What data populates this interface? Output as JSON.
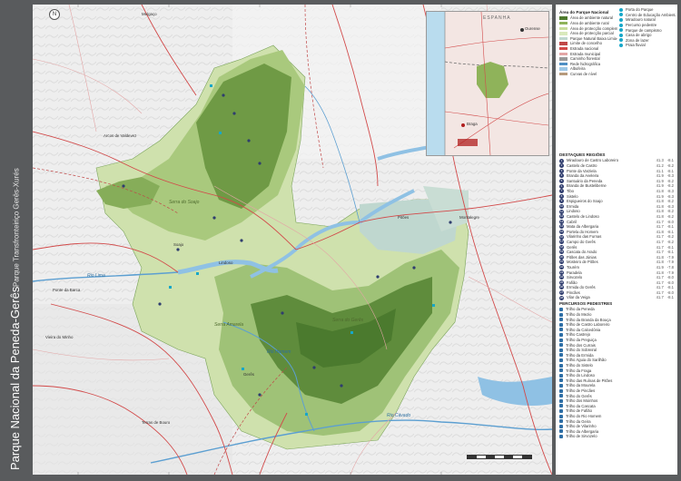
{
  "side_title": {
    "main": "Parque Nacional da Peneda-Gerês",
    "sub": "Parque Transfronteiriço Gerês-Xurés"
  },
  "compass": "N",
  "inset": {
    "country": "ESPANHA",
    "city1": "Ourense",
    "city2": "Braga"
  },
  "places": [
    {
      "id": "arcos",
      "label": "Arcos de Valdevez"
    },
    {
      "id": "ponte",
      "label": "Ponte da Barca"
    },
    {
      "id": "vieira",
      "label": "Vieira do Minho"
    },
    {
      "id": "terras",
      "label": "Terras de Bouro"
    },
    {
      "id": "montalegre",
      "label": "Montalegre"
    },
    {
      "id": "melgaco",
      "label": "Melgaço"
    },
    {
      "id": "soajo",
      "label": "Soajo"
    },
    {
      "id": "geres",
      "label": "Gerês"
    },
    {
      "id": "lindoso",
      "label": "Lindoso"
    },
    {
      "id": "pitoes",
      "label": "Pitões"
    }
  ],
  "rivers": [
    {
      "label": "Rio Lima"
    },
    {
      "label": "Rio Cávado"
    },
    {
      "label": "Rio Homem"
    }
  ],
  "serras": [
    {
      "label": "Serra do Soajo"
    },
    {
      "label": "Serra do Gerês"
    },
    {
      "label": "Serra Amarela"
    }
  ],
  "legend": {
    "section1": "Área do Parque Nacional",
    "items1": [
      {
        "label": "Área de ambiente natural",
        "color": "#4f7a2f"
      },
      {
        "label": "Área de ambiente rural",
        "color": "#8fb35a"
      },
      {
        "label": "Área de protecção complementar",
        "color": "#c8dc9c"
      },
      {
        "label": "Área de protecção parcial",
        "color": "#d9e9bd"
      },
      {
        "label": "Parque Natural Baixa Limia-Serra do Xurés",
        "color": "#bfd7cf"
      },
      {
        "label": "Limite de concelho",
        "color": "#c04848"
      },
      {
        "label": "Estrada nacional",
        "color": "#d24a4a"
      },
      {
        "label": "Estrada municipal",
        "color": "#e3a6a6"
      },
      {
        "label": "Caminho florestal",
        "color": "#9a9a9a"
      },
      {
        "label": "Rede hidrográfica",
        "color": "#4e8fc4"
      },
      {
        "label": "Albufeira",
        "color": "#9cc7e6"
      },
      {
        "label": "Curvas de nível",
        "color": "#b69a7c"
      }
    ],
    "items2": [
      {
        "label": "Porta do Parque"
      },
      {
        "label": "Centro de Educação Ambiental"
      },
      {
        "label": "Miradouro natural"
      },
      {
        "label": "Percurso pedestre"
      },
      {
        "label": "Parque de campismo"
      },
      {
        "label": "Casa de abrigo"
      },
      {
        "label": "Zona de lazer"
      },
      {
        "label": "Praia fluvial"
      }
    ],
    "section2": "DESTAQUES REGIÕES",
    "points": [
      {
        "n": "1",
        "label": "Miradouro de Castro Laboreiro",
        "a": "41.3",
        "b": "-8.1"
      },
      {
        "n": "2",
        "label": "Castelo de Castro",
        "a": "41.2",
        "b": "-8.2"
      },
      {
        "n": "3",
        "label": "Ponte da Varziela",
        "a": "41.1",
        "b": "-8.1"
      },
      {
        "n": "4",
        "label": "Branda da Aveleira",
        "a": "41.9",
        "b": "-8.3"
      },
      {
        "n": "5",
        "label": "Santuário da Peneda",
        "a": "41.9",
        "b": "-8.2"
      },
      {
        "n": "6",
        "label": "Branda de Busteliberne",
        "a": "41.9",
        "b": "-8.2"
      },
      {
        "n": "7",
        "label": "Tibo",
        "a": "41.8",
        "b": "-8.3"
      },
      {
        "n": "8",
        "label": "Sistelo",
        "a": "41.9",
        "b": "-8.3"
      },
      {
        "n": "9",
        "label": "Espigueiros do Soajo",
        "a": "41.8",
        "b": "-8.2"
      },
      {
        "n": "10",
        "label": "Ermida",
        "a": "41.8",
        "b": "-8.3"
      },
      {
        "n": "11",
        "label": "Lindoso",
        "a": "41.8",
        "b": "-8.2"
      },
      {
        "n": "12",
        "label": "Castelo de Lindoso",
        "a": "41.8",
        "b": "-8.2"
      },
      {
        "n": "13",
        "label": "Cabril",
        "a": "41.7",
        "b": "-8.0"
      },
      {
        "n": "14",
        "label": "Mata da Albergaria",
        "a": "41.7",
        "b": "-8.1"
      },
      {
        "n": "15",
        "label": "Portela do Homem",
        "a": "41.8",
        "b": "-8.1"
      },
      {
        "n": "16",
        "label": "Vilarinho das Furnas",
        "a": "41.7",
        "b": "-8.2"
      },
      {
        "n": "17",
        "label": "Campo do Gerês",
        "a": "41.7",
        "b": "-8.2"
      },
      {
        "n": "18",
        "label": "Gerês",
        "a": "41.7",
        "b": "-8.1"
      },
      {
        "n": "19",
        "label": "Cascata do Arado",
        "a": "41.7",
        "b": "-8.1"
      },
      {
        "n": "20",
        "label": "Pitões das Júnias",
        "a": "41.8",
        "b": "-7.9"
      },
      {
        "n": "21",
        "label": "Mosteiro de Pitões",
        "a": "41.8",
        "b": "-7.9"
      },
      {
        "n": "22",
        "label": "Tourém",
        "a": "41.9",
        "b": "-7.8"
      },
      {
        "n": "23",
        "label": "Paradela",
        "a": "41.8",
        "b": "-7.9"
      },
      {
        "n": "24",
        "label": "Sirvozelo",
        "a": "41.7",
        "b": "-8.0"
      },
      {
        "n": "25",
        "label": "Fafião",
        "a": "41.7",
        "b": "-8.0"
      },
      {
        "n": "26",
        "label": "Ermida do Gerês",
        "a": "41.7",
        "b": "-8.1"
      },
      {
        "n": "27",
        "label": "Pincães",
        "a": "41.7",
        "b": "-8.0"
      },
      {
        "n": "28",
        "label": "Vilar da Veiga",
        "a": "41.7",
        "b": "-8.1"
      }
    ],
    "section3": "PERCURSOS PEDESTRES",
    "trails": [
      {
        "label": "Trilho da Peneda"
      },
      {
        "label": "Trilho do Mezio"
      },
      {
        "label": "Trilho da Branda da Bouça"
      },
      {
        "label": "Trilho de Castro Laboreiro"
      },
      {
        "label": "Trilho da Calcedónia"
      },
      {
        "label": "Trilho Castrejo"
      },
      {
        "label": "Trilho da Preguiça"
      },
      {
        "label": "Trilho dos Currais"
      },
      {
        "label": "Trilho do Sobreiral"
      },
      {
        "label": "Trilho da Ermida"
      },
      {
        "label": "Trilho Águia do Sarilhão"
      },
      {
        "label": "Trilho do Sistelo"
      },
      {
        "label": "Trilho da Fraga"
      },
      {
        "label": "Trilho do Lindoso"
      },
      {
        "label": "Trilho das Ruínas de Pitões"
      },
      {
        "label": "Trilho da Mourela"
      },
      {
        "label": "Trilho de Pincães"
      },
      {
        "label": "Trilho do Gerês"
      },
      {
        "label": "Trilho dos Moinhos"
      },
      {
        "label": "Trilho da Cascata"
      },
      {
        "label": "Trilho de Fafião"
      },
      {
        "label": "Trilho do Rio Homem"
      },
      {
        "label": "Trilho da Geira"
      },
      {
        "label": "Trilho de Vilarinho"
      },
      {
        "label": "Trilho da Albergaria"
      },
      {
        "label": "Trilho de Sirvozelo"
      }
    ]
  }
}
